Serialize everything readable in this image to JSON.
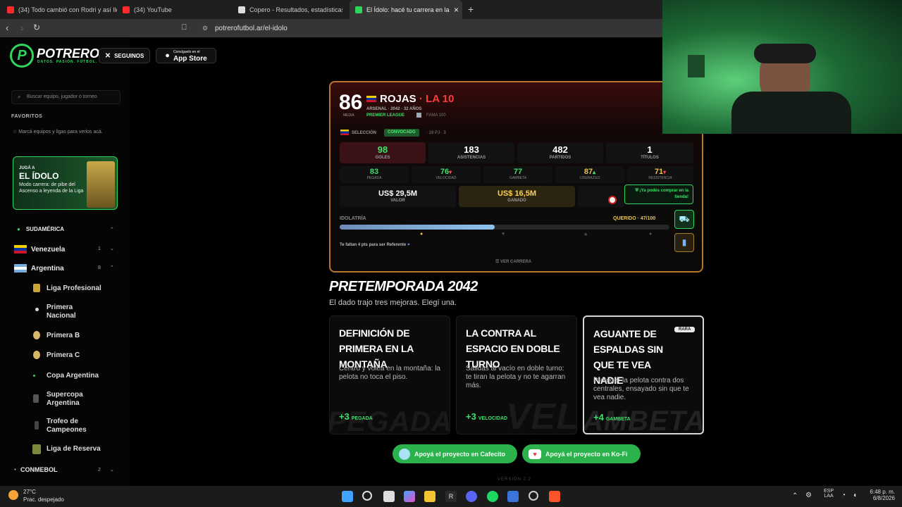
{
  "browser": {
    "tabs": [
      {
        "title": "(34) Todo cambió con Rodri y así lleg",
        "icon_color": "#ff2a2a"
      },
      {
        "title": "(34) YouTube",
        "icon_color": "#ff2a2a"
      },
      {
        "title": "Copero - Resultados, estadísticas, ani",
        "icon_color": "#dddddd"
      },
      {
        "title": "El Ídolo: hacé tu carrera en la Lig",
        "icon_color": "#2fd65b"
      }
    ],
    "url": "potrerofutbol.ar/el-idolo",
    "new_tab": "+",
    "close_tab": "×"
  },
  "header": {
    "logo_letter": "P",
    "brand": "POTRERO",
    "tagline": "DATOS. PASIÓN. FÚTBOL.",
    "follow_label": "SEGUINOS",
    "follow_icon": "x-icon",
    "store_small": "Consíguelo en el",
    "store_big": "App Store"
  },
  "sidebar": {
    "search_placeholder": "Buscar equipo, jugador o torneo",
    "favorites_heading": "FAVORITOS",
    "favorites_hint": "Marcá equipos y ligas para verlos acá.",
    "promo": {
      "kicker": "JUGÁ A",
      "title": "EL ÍDOLO",
      "text": "Modo carrera: de pibe del Ascenso a leyenda de la Liga"
    },
    "region": "SUDAMÉRICA",
    "countries": [
      {
        "name": "Venezuela",
        "count": "1"
      },
      {
        "name": "Argentina",
        "count": "8"
      }
    ],
    "leagues": [
      "Liga Profesional",
      "Primera Nacional",
      "Primera B",
      "Primera C",
      "Copa Argentina",
      "Supercopa Argentina",
      "Trofeo de Campeones",
      "Liga de Reserva"
    ],
    "conmebol": {
      "name": "CONMEBOL",
      "count": "2"
    }
  },
  "player": {
    "rating": "86",
    "rating_label": "MEDIA",
    "name": "ROJAS",
    "nickname": "LA 10",
    "club_line": "ARSENAL · 2042 · 32 AÑOS",
    "league": "PREMIER LEAGUE",
    "fame": "FAMA 100",
    "selection_label": "SELECCIÓN",
    "selection_status": "CONVOCADO",
    "selection_stats": "· 19 PJ · 3",
    "stats": [
      {
        "value": "98",
        "label": "GOLES"
      },
      {
        "value": "183",
        "label": "ASISTENCIAS"
      },
      {
        "value": "482",
        "label": "PARTIDOS"
      },
      {
        "value": "1",
        "label": "TÍTULOS"
      }
    ],
    "attributes": [
      {
        "value": "83",
        "label": "PEGADA",
        "trend": ""
      },
      {
        "value": "76",
        "label": "VELOCIDAD",
        "trend": "▾"
      },
      {
        "value": "77",
        "label": "GAMBETA",
        "trend": ""
      },
      {
        "value": "87",
        "label": "LIDERAZGO",
        "trend": "▴"
      },
      {
        "value": "71",
        "label": "RESISTENCIA",
        "trend": "▾"
      }
    ],
    "money": [
      {
        "value": "US$ 29,5M",
        "label": "VALOR"
      },
      {
        "value": "US$ 16,5M",
        "label": "GANADO"
      }
    ],
    "shop_message": "¡Ya podés comprar en la tienda!",
    "idolatry_label": "IDOLATRÍA",
    "idolatry_status": "QUERIDO · 47/100",
    "idolatry_value": 0.47,
    "idolatry_hint": "Te faltan 4 pts para ser Referente",
    "career_link": "VER CARRERA"
  },
  "preseason": {
    "title": "PRETEMPORADA 2042",
    "subtitle": "El dado trajo tres mejoras. Elegí una.",
    "options": [
      {
        "title": "Definición de primera en la montaña",
        "desc": "Centro y volea en la montaña: la pelota no toca el piso.",
        "bonus": "+3",
        "attr": "PEGADA",
        "watermark": "PEGADA",
        "badge": ""
      },
      {
        "title": "La contra al espacio en doble turno",
        "desc": "Salidas al vacío en doble turno: te tiran la pelota y no te agarran más.",
        "bonus": "+3",
        "attr": "VELOCIDAD",
        "watermark": "VEL",
        "badge": ""
      },
      {
        "title": "Aguante de espaldas sin que te vea nadie",
        "desc": "Proteger la pelota contra dos centrales, ensayado sin que te vea nadie.",
        "bonus": "+4",
        "attr": "GAMBETA",
        "watermark": "GAMBETA",
        "badge": "RARA"
      }
    ]
  },
  "support": {
    "cafecito": "Apoyá el proyecto en Cafecito",
    "kofi": "Apoyá el proyecto en Ko-Fi",
    "version": "VERSIÓN 2.2"
  },
  "taskbar": {
    "temp": "27°C",
    "weather": "Prac. despejado",
    "lang1": "ESP",
    "lang2": "LAA",
    "time": "6:48 p. m.",
    "date": "6/8/2026"
  }
}
